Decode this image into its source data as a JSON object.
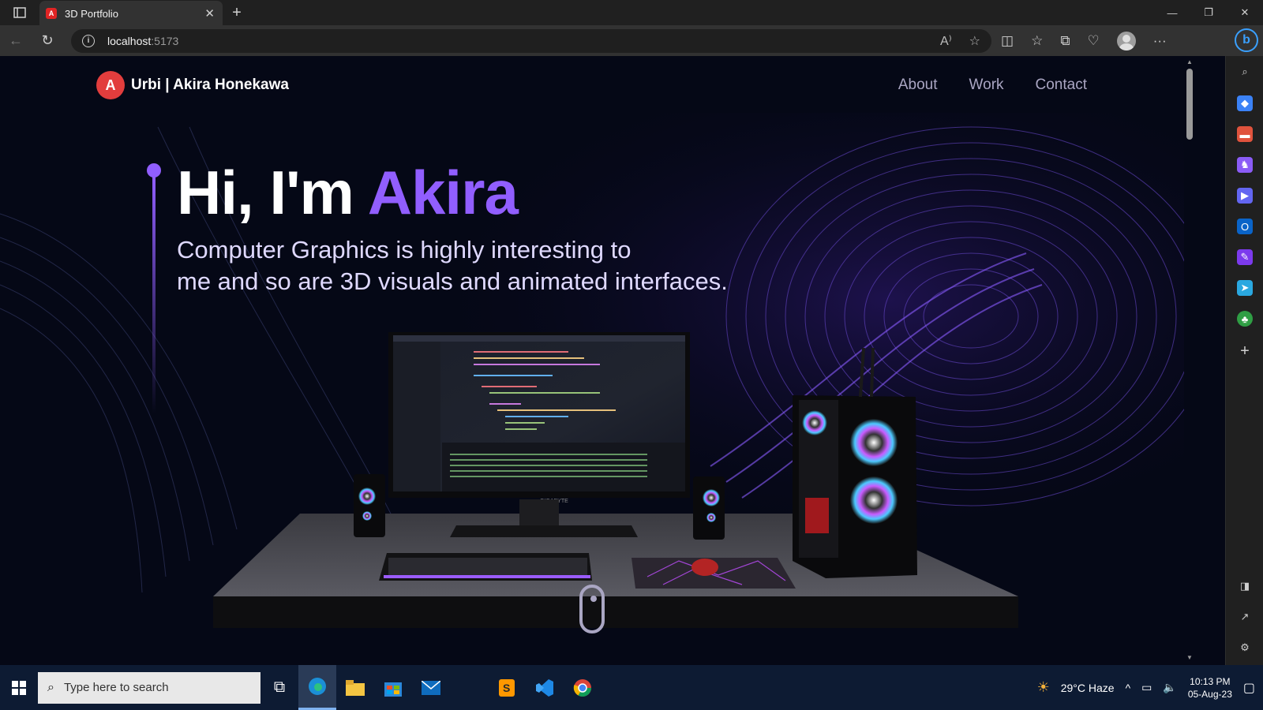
{
  "browser": {
    "tab_title": "3D Portfolio",
    "favicon_letter": "A",
    "url_host": "localhost",
    "url_port": ":5173",
    "bing_label": "b"
  },
  "site": {
    "logo_letter": "A",
    "brand": "Urbi | Akira Honekawa",
    "nav": [
      "About",
      "Work",
      "Contact"
    ],
    "hero_title_prefix": "Hi, I'm ",
    "hero_title_name": "Akira",
    "hero_subtitle_line1": "Computer Graphics is highly interesting to",
    "hero_subtitle_line2": "me and so are 3D visuals and animated interfaces.",
    "monitor_brand": "GIGABYTE",
    "colors": {
      "accent": "#915eff",
      "background": "#050816",
      "secondary": "#aaa6c3"
    }
  },
  "taskbar": {
    "search_placeholder": "Type here to search",
    "weather": "29°C  Haze",
    "time": "10:13 PM",
    "date": "05-Aug-23"
  }
}
